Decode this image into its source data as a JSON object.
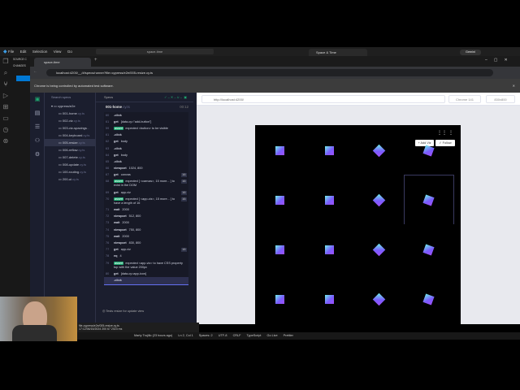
{
  "vscode": {
    "menu": [
      "File",
      "Edit",
      "Selection",
      "View",
      "Go"
    ],
    "search": "space-time",
    "side_label": "SOURCE C",
    "changes": "CHANGES",
    "terminal_lines": [
      "file-cypress/e2e/005-resize.cy.ts",
      "17:12/06/15/2024 200 67 2023 ms"
    ],
    "status": [
      "Marty Trujillo (23 hours ago)",
      "Ln 2, Col 1",
      "Spaces: 2",
      "UTF-8",
      "CRLF",
      "TypeScript",
      "Go Live",
      "Prettier"
    ]
  },
  "other_window": {
    "tab_title": "Space & Time",
    "gemini": "Gemini"
  },
  "chrome": {
    "tab_title": "space-time",
    "url": "localhost:4200/__/#/specs/runner?file=cypress/e2e/005-resize.cy.ts",
    "infobar": "Chrome is being controlled by automated test software."
  },
  "cypress": {
    "search_placeholder": "Search specs",
    "log_title": "Specs",
    "folder": "cypress/e2e",
    "specs": [
      {
        "name": "001-home",
        "ext": ".cy.ts"
      },
      {
        "name": "002-viz",
        "ext": ".cy.ts"
      },
      {
        "name": "003-viz-spacings",
        "ext": "..."
      },
      {
        "name": "004-keyboard",
        "ext": ".cy.ts"
      },
      {
        "name": "005-resize",
        "ext": ".cy.ts",
        "active": true
      },
      {
        "name": "006-reflow",
        "ext": ".cy.ts"
      },
      {
        "name": "007-delete",
        "ext": ".cy.ts"
      },
      {
        "name": "008-update",
        "ext": ".cy.ts"
      },
      {
        "name": "100-routing",
        "ext": ".cy.ts"
      },
      {
        "name": "200-ui",
        "ext": ".cy.ts"
      }
    ],
    "suite": "001-home",
    "suite_ext": ".cy.ts",
    "suite_time": "00:12",
    "commands": [
      {
        "n": "60",
        "k": "-click",
        "t": ""
      },
      {
        "n": "61",
        "k": "get",
        "t": "[data-cy=\"add-button\"]"
      },
      {
        "n": "59",
        "k": "-assert",
        "t": "expected <button> to be visible",
        "badge": "assert"
      },
      {
        "n": "61",
        "k": "-click",
        "t": ""
      },
      {
        "n": "62",
        "k": "get",
        "t": "body"
      },
      {
        "n": "63",
        "k": "-click",
        "t": ""
      },
      {
        "n": "64",
        "k": "get",
        "t": "body"
      },
      {
        "n": "65",
        "k": "-click",
        "t": ""
      },
      {
        "n": "66",
        "k": "viewport",
        "t": "1024, 800"
      },
      {
        "n": "67",
        "k": "get",
        "t": "canvas",
        "c": "16"
      },
      {
        "n": "68",
        "k": "-assert",
        "t": "expected [ <canvas>, 15 more... ] to exist in the DOM",
        "badge": "assert",
        "c": "16"
      },
      {
        "n": "69",
        "k": "get",
        "t": "app-viz",
        "c": "16"
      },
      {
        "n": "70",
        "k": "-assert",
        "t": "expected [ <app-viz>, 15 more... ] to have a length of 16",
        "badge": "assert",
        "c": "16"
      },
      {
        "n": "71",
        "k": "wait",
        "t": "2000"
      },
      {
        "n": "72",
        "k": "viewport",
        "t": "512, 800"
      },
      {
        "n": "73",
        "k": "wait",
        "t": "2000"
      },
      {
        "n": "74",
        "k": "viewport",
        "t": "750, 800"
      },
      {
        "n": "75",
        "k": "wait",
        "t": "2000"
      },
      {
        "n": "76",
        "k": "viewport",
        "t": "830, 800"
      },
      {
        "n": "77",
        "k": "get",
        "t": "app-viz",
        "c": "16"
      },
      {
        "n": "78",
        "k": "eq",
        "t": "4"
      },
      {
        "n": "79",
        "k": "-assert",
        "t": "expected <app-viz> to have CSS property top with the value 200px",
        "badge": "assert"
      },
      {
        "n": "80",
        "k": "get",
        "t": "[data-cy=app-icon]"
      },
      {
        "n": "",
        "k": "-click",
        "t": "",
        "active": true
      }
    ],
    "footer": "Tests resize for update view",
    "aut_url": "http://localhost:4200/",
    "browser": "Chrome 141",
    "viewport": "830x800",
    "add_viz": "Add Viz",
    "follow": "Follow"
  }
}
